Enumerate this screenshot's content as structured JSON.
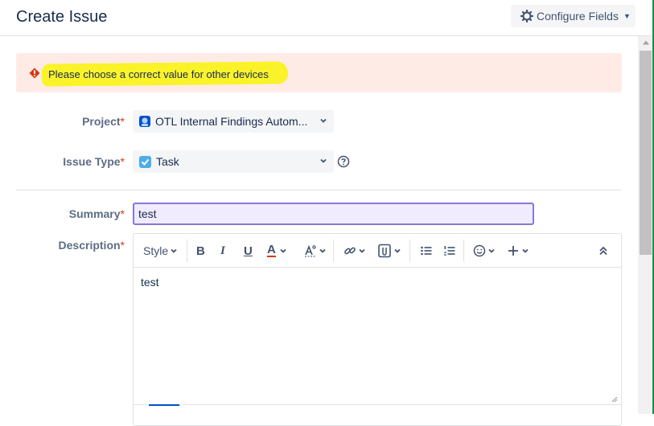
{
  "dialog": {
    "title": "Create Issue",
    "configure_label": "Configure Fields"
  },
  "error": {
    "message": "Please choose a correct value for other devices"
  },
  "fields": {
    "project": {
      "label": "Project",
      "required": "*",
      "value": "OTL Internal Findings Autom..."
    },
    "issue_type": {
      "label": "Issue Type",
      "required": "*",
      "value": "Task"
    },
    "summary": {
      "label": "Summary",
      "required": "*",
      "value": "test"
    },
    "description": {
      "label": "Description",
      "required": "*",
      "value": "test"
    }
  },
  "toolbar": {
    "style_label": "Style",
    "bold_label": "B",
    "italic_label": "I",
    "underline_label": "U",
    "color_label": "A",
    "icons": [
      "text-style-icon",
      "bold-icon",
      "italic-icon",
      "underline-icon",
      "text-color-icon",
      "more-formatting-icon",
      "link-icon",
      "attachment-icon",
      "bullet-list-icon",
      "numbered-list-icon",
      "emoji-icon",
      "insert-more-icon",
      "collapse-toolbar-icon"
    ]
  },
  "colors": {
    "error_bg": "#ffebe6",
    "error_icon": "#de350b",
    "highlight": "#faf32a",
    "focus_border": "#8777d9",
    "required": "#de350b"
  }
}
